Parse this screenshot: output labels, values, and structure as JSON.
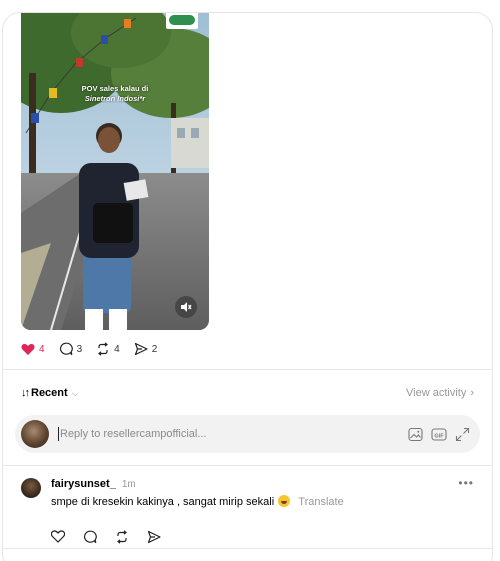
{
  "post": {
    "video": {
      "overlay_line1": "POV sales kalau di",
      "overlay_line2": "Sinetron Indosi*r"
    },
    "actions": {
      "likes": "4",
      "comments": "3",
      "reposts": "4",
      "shares": "2"
    }
  },
  "replies_section": {
    "sort_label": "Recent",
    "view_activity_label": "View activity"
  },
  "reply_bar": {
    "placeholder": "Reply to resellercampofficial..."
  },
  "comment": {
    "username": "fairysunset_",
    "time": "1m",
    "text": "smpe di kresekin kakinya , sangat mirip sekali",
    "translate_label": "Translate",
    "more_label": "•••"
  },
  "colors": {
    "like_red": "#e0245e",
    "muted_text": "#999999",
    "divider": "#e8e8e8"
  },
  "icons": [
    "heart-icon",
    "comment-icon",
    "repost-icon",
    "share-icon",
    "mute-icon",
    "image-icon",
    "gif-icon",
    "expand-icon",
    "more-icon"
  ]
}
